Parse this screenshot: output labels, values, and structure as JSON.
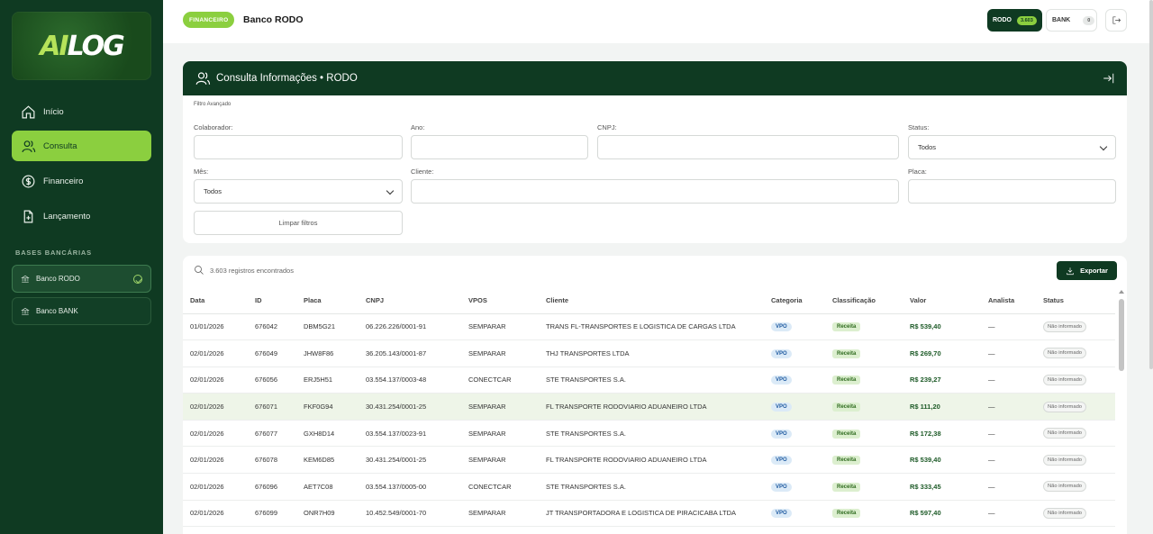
{
  "logo": {
    "part1": "AI",
    "part2": "LOG"
  },
  "sidebar": {
    "items": [
      {
        "label": "Início",
        "icon": "home-icon"
      },
      {
        "label": "Consulta",
        "icon": "user-icon"
      },
      {
        "label": "Financeiro",
        "icon": "dollar-icon"
      },
      {
        "label": "Lançamento",
        "icon": "file-add-icon"
      }
    ],
    "section_title": "BASES BANCÁRIAS",
    "banks": [
      {
        "label": "Banco RODO",
        "icon": "bank-icon"
      },
      {
        "label": "Banco BANK",
        "icon": "bank-icon"
      }
    ]
  },
  "topbar": {
    "tag": "FINANCEIRO",
    "title": "Banco RODO",
    "rodo_label": "RODO",
    "rodo_count": "3.603",
    "bank_label": "BANK",
    "bank_count": "0"
  },
  "filter": {
    "header": "Consulta Informações • RODO",
    "section": "Filtro Avançado",
    "colaborador_label": "Colaborador:",
    "ano_label": "Ano:",
    "cnpj_label": "CNPJ:",
    "status_label": "Status:",
    "status_value": "Todos",
    "mes_label": "Mês:",
    "mes_value": "Todos",
    "cliente_label": "Cliente:",
    "placa_label": "Placa:",
    "clear_button": "Limpar filtros"
  },
  "table": {
    "count_text": "3.603 registros encontrados",
    "export_label": "Exportar",
    "headers": [
      "Data",
      "ID",
      "Placa",
      "CNPJ",
      "VPOS",
      "Cliente",
      "Categoria",
      "Classificação",
      "Valor",
      "Analista",
      "Status"
    ],
    "rows": [
      {
        "data": "01/01/2026",
        "id": "676042",
        "placa": "DBM5G21",
        "cnpj": "06.226.226/0001-91",
        "vpos": "SEMPARAR",
        "cliente": "TRANS FL-TRANSPORTES E LOGISTICA DE CARGAS LTDA",
        "categoria": "VPO",
        "classificacao": "Receita",
        "valor": "R$ 539,40",
        "analista": "—",
        "status": "Não informado"
      },
      {
        "data": "02/01/2026",
        "id": "676049",
        "placa": "JHW8F86",
        "cnpj": "36.205.143/0001-87",
        "vpos": "SEMPARAR",
        "cliente": "THJ TRANSPORTES LTDA",
        "categoria": "VPO",
        "classificacao": "Receita",
        "valor": "R$ 269,70",
        "analista": "—",
        "status": "Não informado"
      },
      {
        "data": "02/01/2026",
        "id": "676056",
        "placa": "ERJ5H51",
        "cnpj": "03.554.137/0003-48",
        "vpos": "CONECTCAR",
        "cliente": "STE TRANSPORTES S.A.",
        "categoria": "VPO",
        "classificacao": "Receita",
        "valor": "R$ 239,27",
        "analista": "—",
        "status": "Não informado"
      },
      {
        "data": "02/01/2026",
        "id": "676071",
        "placa": "FKF0G94",
        "cnpj": "30.431.254/0001-25",
        "vpos": "SEMPARAR",
        "cliente": "FL TRANSPORTE RODOVIARIO ADUANEIRO LTDA",
        "categoria": "VPO",
        "classificacao": "Receita",
        "valor": "R$ 111,20",
        "analista": "—",
        "status": "Não informado"
      },
      {
        "data": "02/01/2026",
        "id": "676077",
        "placa": "GXH8D14",
        "cnpj": "03.554.137/0023-91",
        "vpos": "SEMPARAR",
        "cliente": "STE TRANSPORTES S.A.",
        "categoria": "VPO",
        "classificacao": "Receita",
        "valor": "R$ 172,38",
        "analista": "—",
        "status": "Não informado"
      },
      {
        "data": "02/01/2026",
        "id": "676078",
        "placa": "KEM6D85",
        "cnpj": "30.431.254/0001-25",
        "vpos": "SEMPARAR",
        "cliente": "FL TRANSPORTE RODOVIARIO ADUANEIRO LTDA",
        "categoria": "VPO",
        "classificacao": "Receita",
        "valor": "R$ 539,40",
        "analista": "—",
        "status": "Não informado"
      },
      {
        "data": "02/01/2026",
        "id": "676096",
        "placa": "AET7C08",
        "cnpj": "03.554.137/0005-00",
        "vpos": "CONECTCAR",
        "cliente": "STE TRANSPORTES S.A.",
        "categoria": "VPO",
        "classificacao": "Receita",
        "valor": "R$ 333,45",
        "analista": "—",
        "status": "Não informado"
      },
      {
        "data": "02/01/2026",
        "id": "676099",
        "placa": "ONR7H09",
        "cnpj": "10.452.549/0001-70",
        "vpos": "SEMPARAR",
        "cliente": "JT TRANSPORTADORA E LOGISTICA DE PIRACICABA LTDA",
        "categoria": "VPO",
        "classificacao": "Receita",
        "valor": "R$ 597,40",
        "analista": "—",
        "status": "Não informado"
      }
    ]
  },
  "colors": {
    "dark_green": "#0f3a22",
    "accent_green": "#8bcf3f",
    "row_highlight": "#eef5e8"
  }
}
